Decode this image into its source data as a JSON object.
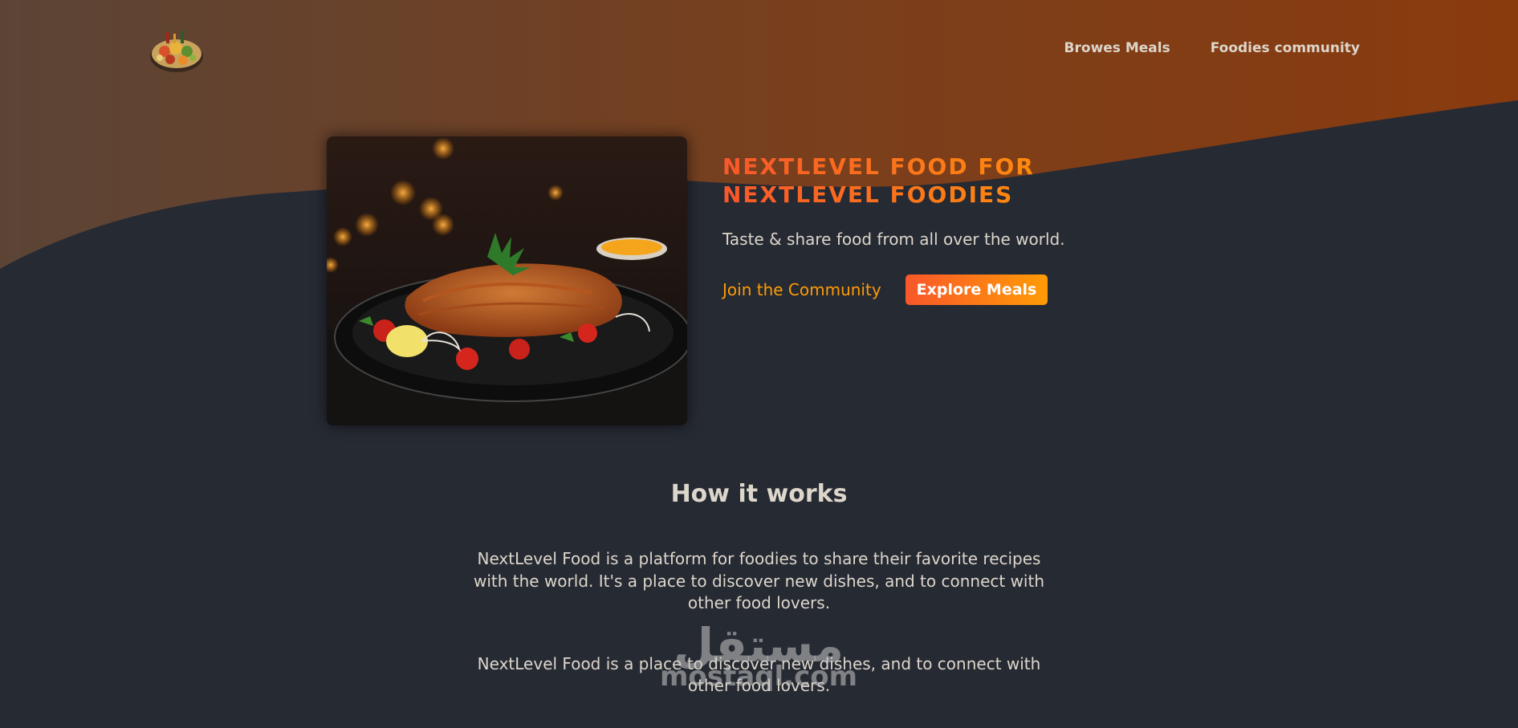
{
  "header": {
    "nav": {
      "browse_meals": "Browes Meals",
      "community": "Foodies community"
    }
  },
  "hero": {
    "title_line1": "NEXTLEVEL FOOD FOR",
    "title_line2": "NEXTLEVEL FOODIES",
    "subtitle": "Taste & share food from all over the world.",
    "join_link": "Join the Community",
    "explore_button": "Explore Meals"
  },
  "how_it_works": {
    "heading": "How it works",
    "paragraph1": "NextLevel Food is a platform for foodies to share their favorite recipes with the world. It's a place to discover new dishes, and to connect with other food lovers.",
    "paragraph2": "NextLevel Food is a place to discover new dishes, and to connect with other food lovers."
  },
  "watermark": {
    "arabic": "مستقل",
    "latin": "mostaql.com"
  },
  "colors": {
    "background": "#262a33",
    "accent_start": "#f9572a",
    "accent_end": "#ff9b05",
    "text": "#ddd6cb",
    "header_gradient_start": "#5b4436",
    "header_gradient_end": "#8a3b0e"
  },
  "icons": {
    "logo": "food-platter-icon"
  }
}
